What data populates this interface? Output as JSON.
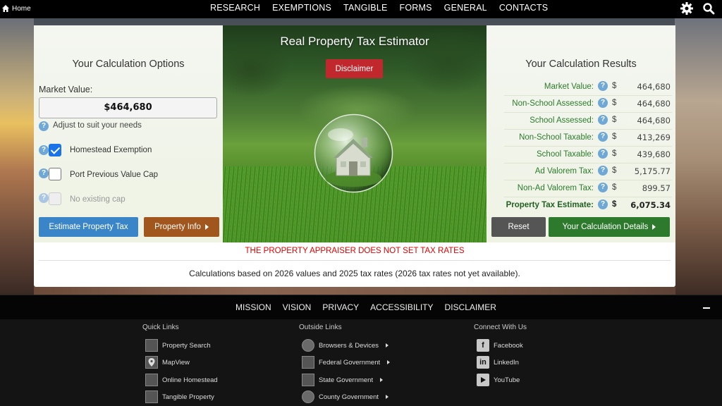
{
  "topnav": {
    "home_label": "Home",
    "links": [
      "RESEARCH",
      "EXEMPTIONS",
      "TANGIBLE",
      "FORMS",
      "GENERAL",
      "CONTACTS"
    ],
    "icons": [
      "gear-icon",
      "search-icon"
    ]
  },
  "left": {
    "title": "Your Calculation Options",
    "market_value_label": "Market Value:",
    "market_value": "$464,680",
    "hint": "Adjust to suit your needs",
    "options": [
      {
        "label": "Homestead Exemption",
        "checked": true,
        "disabled": false
      },
      {
        "label": "Port Previous Value Cap",
        "checked": false,
        "disabled": false
      },
      {
        "label": "No existing cap",
        "checked": false,
        "disabled": true
      }
    ],
    "estimate_button": "Estimate Property Tax",
    "property_info_button": "Property Info"
  },
  "hero": {
    "title": "Real Property Tax Estimator",
    "disclaimer_button": "Disclaimer"
  },
  "right": {
    "title": "Your Calculation Results",
    "currency": "$",
    "results": [
      {
        "label": "Market Value:",
        "value": "464,680"
      },
      {
        "label": "Non-School Assessed:",
        "value": "464,680"
      },
      {
        "label": "School Assessed:",
        "value": "464,680"
      },
      {
        "label": "Non-School Taxable:",
        "value": "413,269"
      },
      {
        "label": "School Taxable:",
        "value": "439,680"
      },
      {
        "label": "Ad Valorem Tax:",
        "value": "5,175.77"
      },
      {
        "label": "Non-Ad Valorem Tax:",
        "value": "899.57"
      },
      {
        "label": "Property Tax Estimate:",
        "value": "6,075.34"
      }
    ],
    "reset_button": "Reset",
    "details_button": "Your Calculation Details"
  },
  "warning": "THE PROPERTY APPRAISER DOES NOT SET TAX RATES",
  "note": "Calculations based on 2026 values and 2025 tax rates (2026 tax rates not yet available).",
  "footer": {
    "links": [
      "MISSION",
      "VISION",
      "PRIVACY",
      "ACCESSIBILITY",
      "DISCLAIMER"
    ],
    "quick_links_title": "Quick Links",
    "quick_links": [
      "Property Search",
      "MapView",
      "Online Homestead",
      "Tangible Property"
    ],
    "outside_links_title": "Outside Links",
    "outside_links": [
      "Browsers & Devices",
      "Federal Government",
      "State Government",
      "County Government"
    ],
    "connect_title": "Connect With Us",
    "social": [
      "Facebook",
      "LinkedIn",
      "YouTube"
    ]
  },
  "colors": {
    "primary_blue": "#3a85c8",
    "brown": "#a0561c",
    "green": "#2d7a2d",
    "disclaimer_red": "#c0282d",
    "warning_red": "#e00000"
  }
}
